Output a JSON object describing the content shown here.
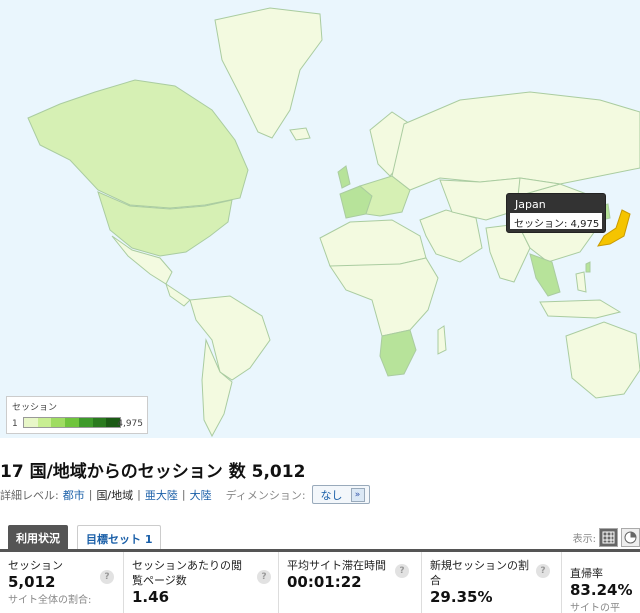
{
  "map": {
    "tooltip": {
      "title": "Japan",
      "body": "セッション: 4,975"
    },
    "legend": {
      "title": "セッション",
      "min": "1",
      "max": "4,975"
    },
    "colors": {
      "ocean": "#eaf6fd",
      "land_default": "#f3fae0",
      "land_low": "#d6f0b4",
      "land_mid": "#b7e39a",
      "land_high": "#f5c400",
      "border": "#aacca0",
      "legend_scale": [
        "#e8f7c8",
        "#c8ee92",
        "#9fdc62",
        "#6fc43c",
        "#3e9a2a",
        "#2a7a1e",
        "#1b5a14"
      ]
    }
  },
  "heading": "17 国/地域からのセッション 数 5,012",
  "detail": {
    "label": "詳細レベル:",
    "links": [
      "都市",
      "国/地域",
      "亜大陸",
      "大陸"
    ],
    "current_index": 1,
    "dimension_label": "ディメンション:",
    "dimension_value": "なし"
  },
  "tabs": [
    {
      "label": "利用状況",
      "active": true
    },
    {
      "label": "目標セット 1",
      "active": false
    }
  ],
  "view": {
    "label": "表示:"
  },
  "metrics": [
    {
      "label": "セッション",
      "value": "5,012",
      "sub": "サイト全体の割合:",
      "help": "?"
    },
    {
      "label": "セッションあたりの閲覧ページ数",
      "value": "1.46",
      "sub": "",
      "help": "?"
    },
    {
      "label": "平均サイト滞在時間",
      "value": "00:01:22",
      "sub": "",
      "help": "?"
    },
    {
      "label": "新規セッションの割合",
      "value": "29.35%",
      "sub": "",
      "help": "?"
    },
    {
      "label": "直帰率",
      "value": "83.24%",
      "sub": "サイトの平均:",
      "help": "?"
    }
  ]
}
